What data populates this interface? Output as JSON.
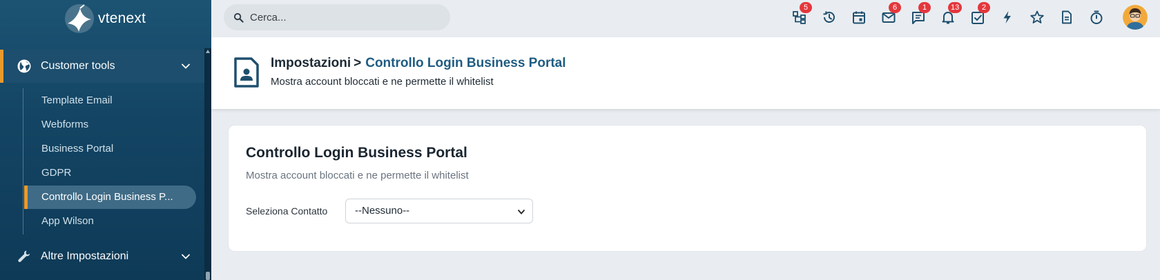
{
  "app": {
    "logo_text": "vtenext"
  },
  "search": {
    "placeholder": "Cerca..."
  },
  "topbar": {
    "icons": [
      {
        "name": "process-icon",
        "badge": "5"
      },
      {
        "name": "history-icon",
        "badge": ""
      },
      {
        "name": "calendar-icon",
        "badge": ""
      },
      {
        "name": "mail-icon",
        "badge": "6"
      },
      {
        "name": "chat-icon",
        "badge": "1"
      },
      {
        "name": "bell-icon",
        "badge": "13"
      },
      {
        "name": "todo-icon",
        "badge": "2"
      },
      {
        "name": "lightning-icon",
        "badge": ""
      },
      {
        "name": "star-icon",
        "badge": ""
      },
      {
        "name": "document-icon",
        "badge": ""
      },
      {
        "name": "timer-icon",
        "badge": ""
      }
    ]
  },
  "sidebar": {
    "group_active": {
      "label": "Customer tools",
      "icon": "globe-icon"
    },
    "items": [
      {
        "label": "Template Email"
      },
      {
        "label": "Webforms"
      },
      {
        "label": "Business Portal"
      },
      {
        "label": "GDPR"
      },
      {
        "label": "Controllo Login Business P..."
      },
      {
        "label": "App Wilson"
      }
    ],
    "group_next": {
      "label": "Altre Impostazioni",
      "icon": "wrench-icon"
    }
  },
  "header": {
    "root": "Impostazioni",
    "separator": ">",
    "current": "Controllo Login Business Portal",
    "subtitle": "Mostra account bloccati e ne permette il whitelist"
  },
  "card": {
    "title": "Controllo Login Business Portal",
    "subtitle": "Mostra account bloccati e ne permette il whitelist",
    "field_label": "Seleziona Contatto",
    "select_value": "--Nessuno--"
  },
  "colors": {
    "sidebar": "#144564",
    "accent": "#e99a2c",
    "primary": "#1f5c82",
    "badge": "#e4373c"
  }
}
